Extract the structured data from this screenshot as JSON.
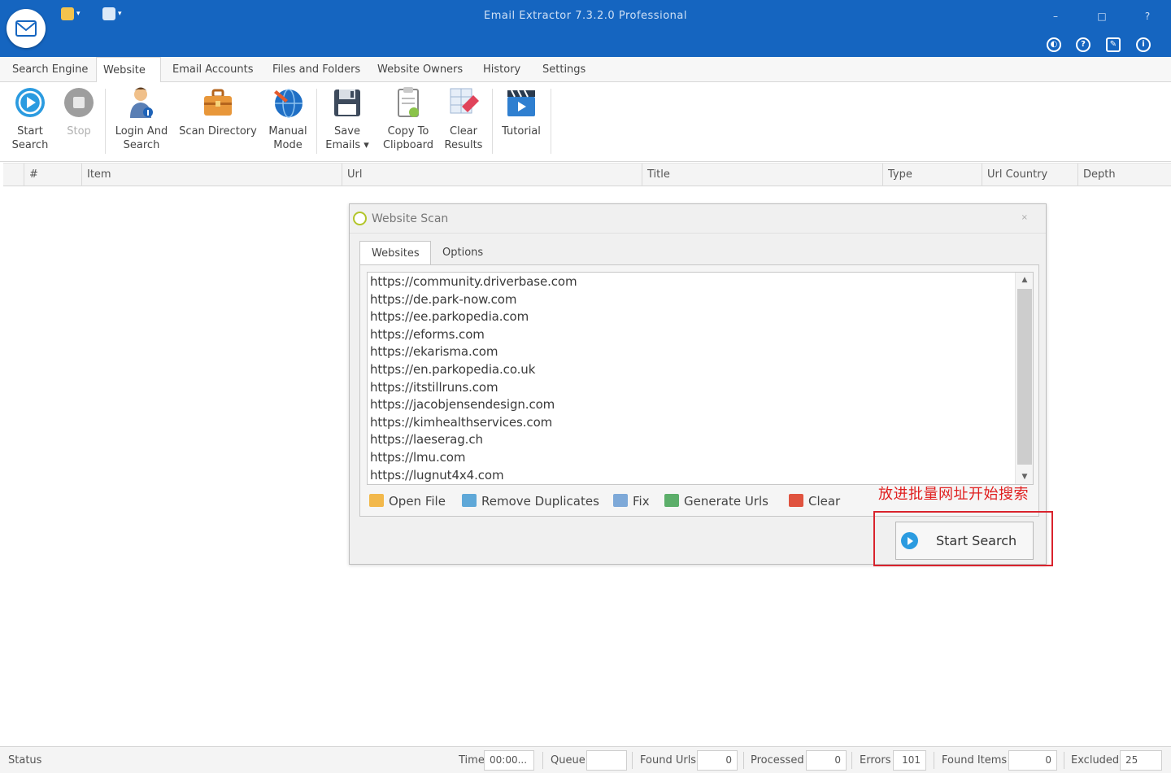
{
  "window": {
    "title": "Email Extractor 7.3.2.0 Professional",
    "minimize_label": "–",
    "maximize_label": "□",
    "close_label": "?"
  },
  "menu_tabs": [
    {
      "label": "Search Engine"
    },
    {
      "label": "Website"
    },
    {
      "label": "Email Accounts"
    },
    {
      "label": "Files and Folders"
    },
    {
      "label": "Website Owners"
    },
    {
      "label": "History"
    },
    {
      "label": "Settings"
    }
  ],
  "active_menu_tab": "Website",
  "ribbon": {
    "start_search": "Start\nSearch",
    "stop": "Stop",
    "login_and_search": "Login And\nSearch",
    "scan_directory": "Scan Directory",
    "manual_mode": "Manual\nMode",
    "save_emails": "Save\nEmails ▾",
    "copy_to_clipboard": "Copy To\nClipboard",
    "clear_results": "Clear\nResults",
    "tutorial": "Tutorial"
  },
  "grid": {
    "columns": [
      "#",
      "Item",
      "Url",
      "Title",
      "Type",
      "Url Country",
      "Depth"
    ]
  },
  "dialog": {
    "title": "Website Scan",
    "close_label": "×",
    "tabs": [
      {
        "label": "Websites"
      },
      {
        "label": "Options"
      }
    ],
    "active_tab": "Websites",
    "urls": [
      "https://community.driverbase.com",
      "https://de.park-now.com",
      "https://ee.parkopedia.com",
      "https://eforms.com",
      "https://ekarisma.com",
      "https://en.parkopedia.co.uk",
      "https://itstillruns.com",
      "https://jacobjensendesign.com",
      "https://kimhealthservices.com",
      "https://laeserag.ch",
      "https://lmu.com",
      "https://lugnut4x4.com"
    ],
    "tools": {
      "open_file": "Open File",
      "remove_duplicates": "Remove Duplicates",
      "fix": "Fix",
      "generate_urls": "Generate Urls",
      "clear": "Clear"
    },
    "annotation": "放进批量网址开始搜索",
    "start_search": "Start Search"
  },
  "statusbar": {
    "status_label": "Status",
    "time_label": "Time",
    "time_value": "00:00...",
    "queue_label": "Queue",
    "queue_value": "",
    "found_urls_label": "Found Urls",
    "found_urls_value": "0",
    "processed_label": "Processed",
    "processed_value": "0",
    "errors_label": "Errors",
    "errors_value": "101",
    "found_items_label": "Found Items",
    "found_items_value": "0",
    "excluded_label": "Excluded",
    "excluded_value": "25"
  },
  "colors": {
    "titlebar": "#1565c0",
    "accent_blue": "#2b9be0",
    "annotation_red": "#d9232d"
  },
  "icons": {
    "app": "envelope-icon",
    "start": "play-circle-icon",
    "stop": "stop-circle-icon",
    "login": "user-key-icon",
    "scan_directory": "briefcase-icon",
    "manual_mode": "globe-pen-icon",
    "save": "floppy-disk-icon",
    "copy": "clipboard-icon",
    "clear": "eraser-icon",
    "tutorial": "film-clapper-icon"
  }
}
